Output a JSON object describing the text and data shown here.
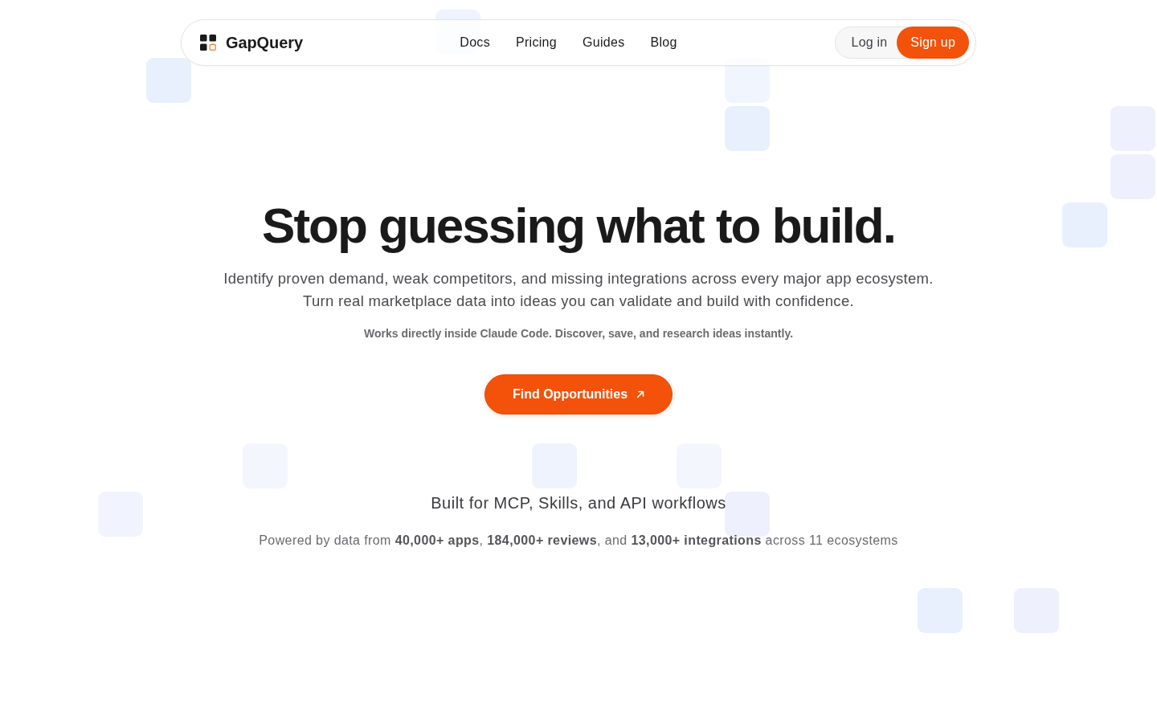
{
  "nav": {
    "brand": "GapQuery",
    "links": [
      {
        "label": "Docs"
      },
      {
        "label": "Pricing"
      },
      {
        "label": "Guides"
      },
      {
        "label": "Blog"
      }
    ],
    "login": "Log in",
    "signup": "Sign up"
  },
  "hero": {
    "headline": "Stop guessing what to build.",
    "subtitle_lines": [
      "Identify proven demand, weak competitors, and missing integrations across every major app ecosystem.",
      "Turn real marketplace data into ideas you can validate and build with confidence."
    ],
    "note": "Works directly inside Claude Code. Discover, save, and research ideas instantly.",
    "cta": "Find Opportunities"
  },
  "workflows": {
    "title": "Built for MCP, Skills, and API workflows",
    "stats": "Powered by data from **40,000+ apps**, **184,000+ reviews**, and **13,000+ integrations** across 11 ecosystems"
  }
}
